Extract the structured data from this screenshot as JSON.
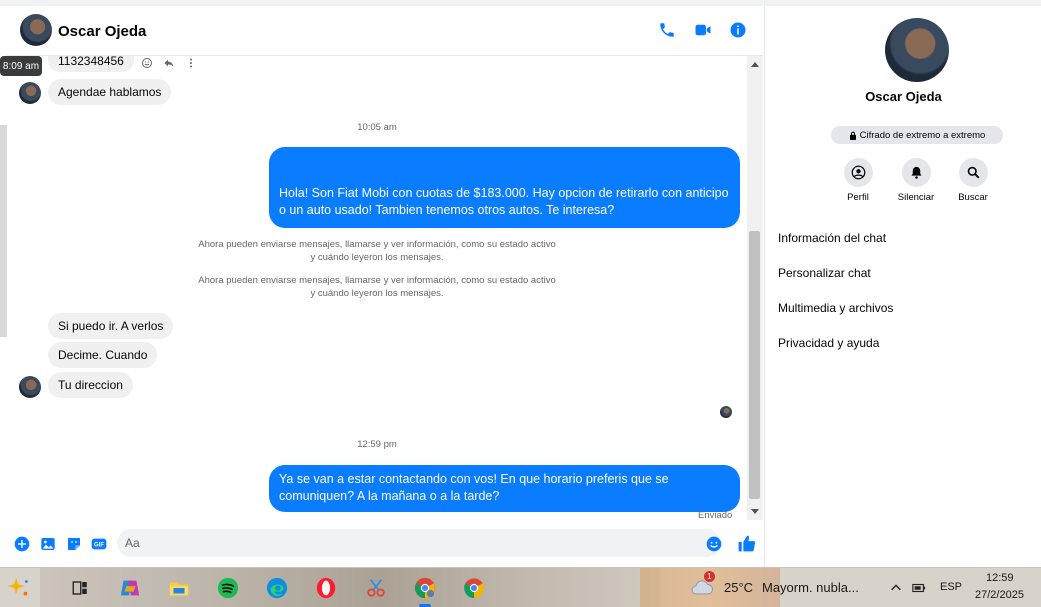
{
  "header": {
    "name": "Oscar Ojeda"
  },
  "tooltip": {
    "time": "8:09 am"
  },
  "messages": {
    "partial_top": "1132348456",
    "in_1": "Agendae hablamos",
    "ts_1": "10:05 am",
    "out_1": "Hola! Son Fiat Mobi con cuotas de $183.000. Hay opcion de retirarlo con anticipo o un auto usado! Tambien tenemos otros autos. Te interesa?",
    "note_1": "Ahora pueden enviarse mensajes, llamarse y ver información, como su estado activo y cuándo leyeron los mensajes.",
    "note_2": "Ahora pueden enviarse mensajes, llamarse y ver información, como su estado activo y cuándo leyeron los mensajes.",
    "in_2": "Si puedo ir. A verlos",
    "in_3": "Decime. Cuando",
    "in_4": "Tu direccion",
    "ts_2": "12:59 pm",
    "out_2": "Ya se van a estar contactando con vos! En que horario preferis que se comuniquen? A la mañana o a la tarde?",
    "status": "Enviado"
  },
  "composer": {
    "placeholder": "Aa"
  },
  "details": {
    "name": "Oscar Ojeda",
    "e2e": "Cifrado de extremo a extremo",
    "actions": [
      "Perfil",
      "Silenciar",
      "Buscar"
    ],
    "rows": [
      "Información del chat",
      "Personalizar chat",
      "Multimedia y archivos",
      "Privacidad y ayuda"
    ]
  },
  "taskbar": {
    "temp": "25°C",
    "weather": "Mayorm. nubla...",
    "weather_alert": "1",
    "lang": "ESP",
    "time": "12:59",
    "date": "27/2/2025"
  },
  "colors": {
    "accent": "#0a7cff",
    "incoming": "#f0f0f0"
  }
}
